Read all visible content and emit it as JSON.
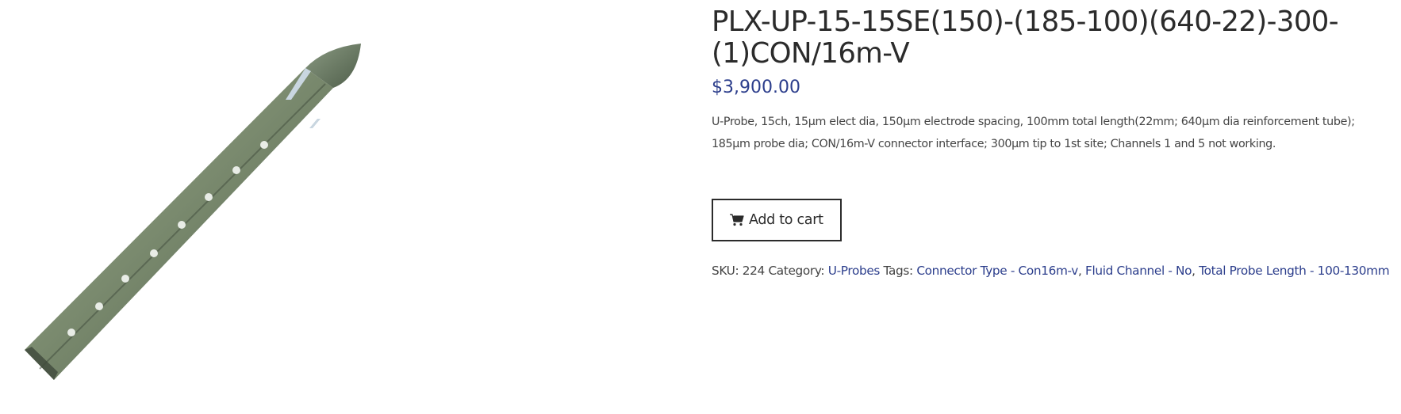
{
  "product": {
    "image_alt": "U-Probe electrode image",
    "title": "PLX-UP-15-15SE(150)-(185-100)(640-22)-300-(1)CON/16m-V",
    "price": "$3,900.00",
    "description": "U-Probe, 15ch, 15µm elect dia, 150µm electrode spacing, 100mm total length(22mm; 640µm dia reinforcement tube); 185µm probe dia; CON/16m-V connector interface; 300µm tip to 1st site; Channels 1 and 5 not working.",
    "add_to_cart_label": "Add to cart",
    "cart_icon": "shopping-cart-icon"
  },
  "meta": {
    "sku_label": "SKU:",
    "sku_value": "224",
    "category_label": "Category:",
    "category": "U-Probes",
    "tags_label": "Tags:",
    "tags": [
      "Connector Type - Con16m-v",
      "Fluid Channel - No",
      "Total Probe Length - 100-130mm"
    ],
    "tag_separator": ", "
  },
  "colors": {
    "link": "#2c3e8c",
    "text": "#444444",
    "title": "#2b2b2b"
  }
}
